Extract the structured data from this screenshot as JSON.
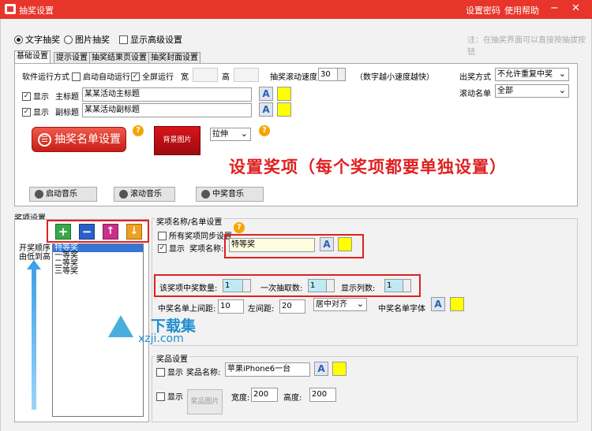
{
  "window": {
    "title": "抽奖设置",
    "link_password": "设置密码",
    "link_help": "使用帮助",
    "min": "−",
    "close": "✕"
  },
  "modes": {
    "text": "文字抽奖",
    "image": "图片抽奖",
    "advanced": "显示高级设置",
    "note": "注：在抽奖界面可以直接按抽拔按钮"
  },
  "tabs": [
    "基础设置",
    "提示设置",
    "抽奖结果页设置",
    "抽奖封面设置"
  ],
  "basic": {
    "run_mode_label": "软件运行方式",
    "auto_run": "启动自动运行",
    "fullscreen": "全屏运行",
    "width_label": "宽",
    "height_label": "高",
    "scroll_speed_label": "抽奖滚动速度",
    "scroll_speed": "30",
    "speed_hint": "（数字越小速度越快）",
    "show": "显示",
    "main_title_label": "主标题",
    "main_title": "某某活动主标题",
    "sub_title_label": "副标题",
    "sub_title": "某某活动副标题",
    "draw_mode_label": "出奖方式",
    "draw_mode": "不允许重复中奖",
    "scroll_list_label": "滚动名单",
    "scroll_list": "全部",
    "list_button": "抽奖名单设置",
    "bg_button": "背景图片",
    "stretch": "拉伸",
    "help": "?",
    "annotation": "设置奖项（每个奖项都要单独设置）",
    "music": [
      "启动音乐",
      "滚动音乐",
      "中奖音乐"
    ]
  },
  "prize_section": {
    "title": "奖项设置",
    "order_label": "开奖顺序由低到高",
    "buttons": [
      "+",
      "−",
      "↑",
      "↓"
    ],
    "items": [
      "特等奖",
      "一等奖",
      "二等奖",
      "三等奖"
    ]
  },
  "prize_name": {
    "group_title": "奖项名称/名单设置",
    "sync": "所有奖项同步设置",
    "show": "显示",
    "name_label": "奖项名称:",
    "name": "特等奖",
    "count_label": "该奖项中奖数量:",
    "count": "1",
    "per_draw_label": "一次抽取数:",
    "per_draw": "1",
    "cols_label": "显示列数:",
    "cols": "1",
    "top_margin_label": "中奖名单上间距:",
    "top_margin": "10",
    "left_margin_label": "左间距:",
    "left_margin": "20",
    "align": "居中对齐",
    "font_label": "中奖名单字体"
  },
  "award": {
    "group_title": "奖品设置",
    "show": "显示",
    "name_label": "奖品名称:",
    "name": "苹果iPhone6一台",
    "show2": "显示",
    "image_button": "奖品图片",
    "width_label": "宽度:",
    "width": "200",
    "height_label": "高度:",
    "height": "200"
  },
  "watermark": {
    "brand": "下载集",
    "url": "xzji.com"
  },
  "colors": {
    "titlebar": "#e8352c",
    "annotation": "#e02020",
    "highlight": "#e02020"
  }
}
